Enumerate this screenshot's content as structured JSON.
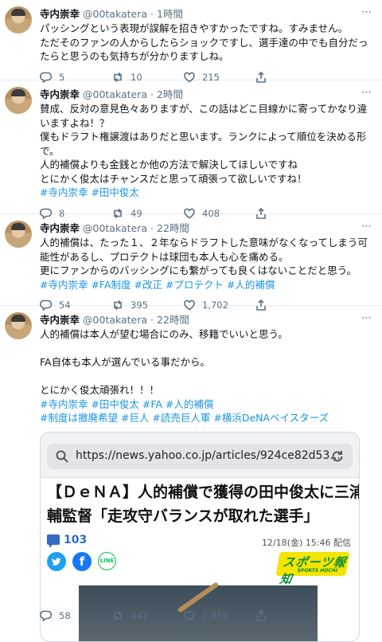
{
  "tweets": [
    {
      "name": "寺内崇幸",
      "handle": "@00takatera",
      "time": "1時間",
      "lines": [
        "パッシングという表現が誤解を招きやすかったですね。すみません。",
        "ただそのファンの人からしたらショックですし、選手達の中でも自分だっ",
        "たらと思うのも気持ちが分かりますしね。"
      ],
      "replies": "5",
      "retweets": "10",
      "likes": "215"
    },
    {
      "name": "寺内崇幸",
      "handle": "@00takatera",
      "time": "2時間",
      "lines": [
        "賛成、反対の意見色々ありますが、この話はどこ目線かに寄ってかなり違",
        "いますよね！？",
        "僕もドラフト権譲渡はありだと思います。ランクによって順位を決める形",
        "で。",
        "人的補償よりも金銭とか他の方法で解決してほしいですね",
        "とにかく俊太はチャンスだと思って頑張って欲しいですね！"
      ],
      "tags": "#寺内崇幸 #田中俊太",
      "replies": "8",
      "retweets": "49",
      "likes": "408"
    },
    {
      "name": "寺内崇幸",
      "handle": "@00takatera",
      "time": "22時間",
      "lines": [
        "人的補償は、たった１、２年ならドラフトした意味がなくなってしまう可",
        "能性があるし、プロテクトは球団も本人も心を痛める。",
        "更にファンからのバッシングにも繋がっても良くはないことだと思う。"
      ],
      "tags": "#寺内崇幸 #FA制度 #改正 #プロテクト #人的補償",
      "replies": "54",
      "retweets": "395",
      "likes": "1,702"
    },
    {
      "name": "寺内崇幸",
      "handle": "@00takatera",
      "time": "22時間",
      "line1": "人的補償は本人が望む場合にのみ、移籍でいいと思う。",
      "line2": "FA自体も本人が選んでいる事だから。",
      "line3": "とにかく俊太頑張れ！！！",
      "tags1": "#寺内崇幸 #田中俊太 #FA #人的補償",
      "tags2": "#制度は撤廃希望 #巨人 #読売巨人軍 #横浜DeNAベイスターズ",
      "card": {
        "url": "https://news.yahoo.co.jp/articles/924ce82d53...",
        "headline1": "【ＤｅＮＡ】人的補償で獲得の田中俊太に三浦大",
        "headline2": "輔監督「走攻守バランスが取れた選手」",
        "comments": "103",
        "date": "12/18(金) 15:46 配信",
        "brand": "スポーツ報知",
        "brand_sub": "SPORTS HOCHI",
        "line_label": "LINE"
      },
      "replies": "58",
      "retweets": "447",
      "likes": "1,856"
    }
  ],
  "more_icon": "⋯"
}
